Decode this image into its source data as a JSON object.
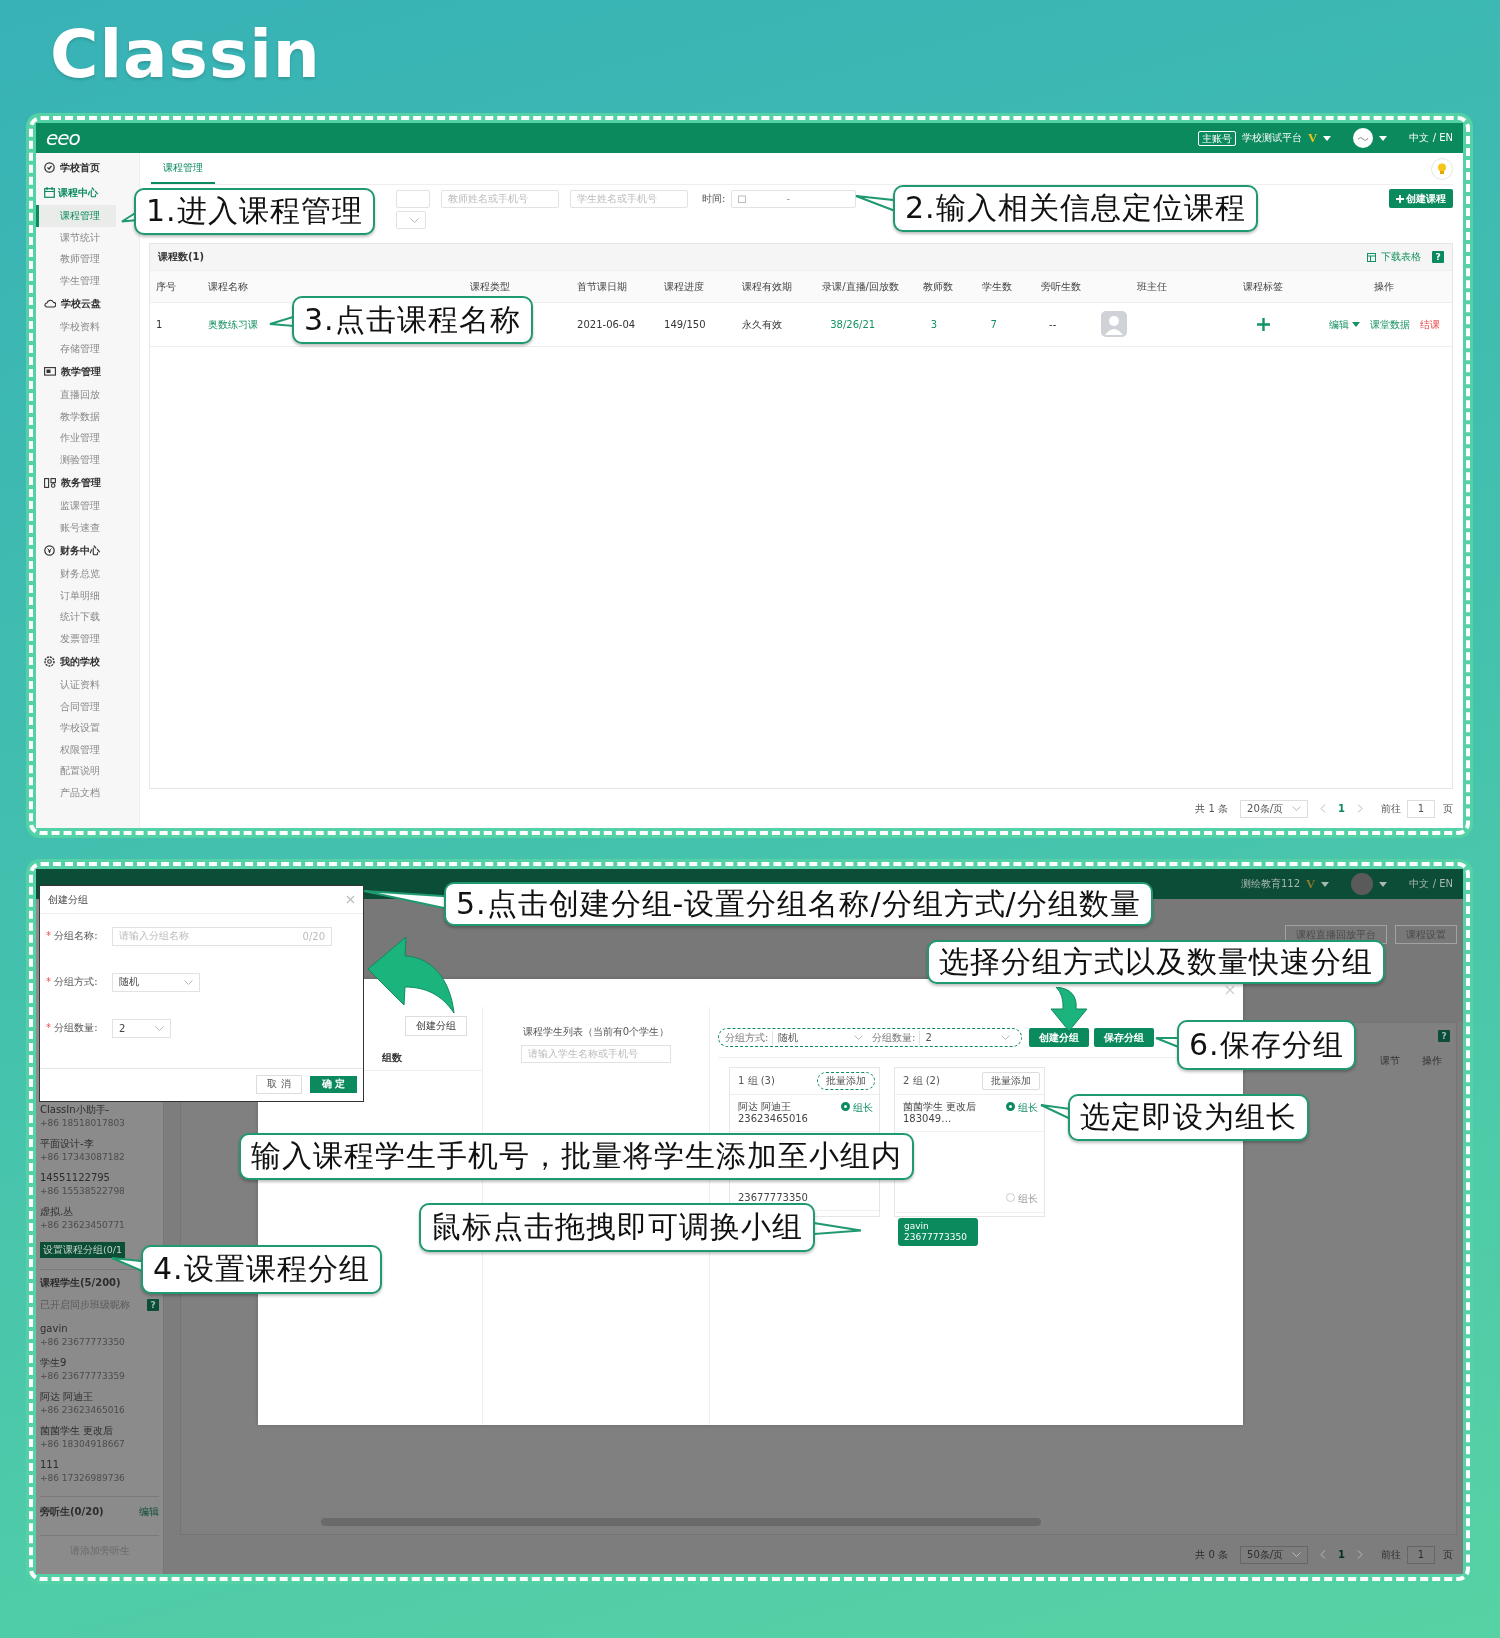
{
  "brand": {
    "logo": "Classin"
  },
  "course_management_screen": {
    "header": {
      "logo": "eeo",
      "account_badge": "主账号",
      "school": "学校测试平台",
      "vip_mark": "V",
      "language": "中文 / EN"
    },
    "sidebar": [
      {
        "label": "学校首页",
        "active": false
      },
      {
        "label": "课程中心",
        "active": true,
        "children": [
          {
            "label": "课程管理",
            "selected": true
          },
          {
            "label": "课节统计",
            "selected": false
          },
          {
            "label": "教师管理",
            "selected": false
          },
          {
            "label": "学生管理",
            "selected": false
          }
        ]
      },
      {
        "label": "学校云盘",
        "active": false,
        "children": [
          {
            "label": "学校资料",
            "selected": false
          },
          {
            "label": "存储管理",
            "selected": false
          }
        ]
      },
      {
        "label": "教学管理",
        "active": false,
        "children": [
          {
            "label": "直播回放",
            "selected": false
          },
          {
            "label": "教学数据",
            "selected": false
          },
          {
            "label": "作业管理",
            "selected": false
          },
          {
            "label": "测验管理",
            "selected": false
          }
        ]
      },
      {
        "label": "教务管理",
        "active": false,
        "children": [
          {
            "label": "监课管理",
            "selected": false
          },
          {
            "label": "账号速查",
            "selected": false
          }
        ]
      },
      {
        "label": "财务中心",
        "active": false,
        "children": [
          {
            "label": "财务总览",
            "selected": false
          },
          {
            "label": "订单明细",
            "selected": false
          },
          {
            "label": "统计下载",
            "selected": false
          },
          {
            "label": "发票管理",
            "selected": false
          }
        ]
      },
      {
        "label": "我的学校",
        "active": false,
        "children": [
          {
            "label": "认证资料",
            "selected": false
          },
          {
            "label": "合同管理",
            "selected": false
          },
          {
            "label": "学校设置",
            "selected": false
          },
          {
            "label": "权限管理",
            "selected": false
          },
          {
            "label": "配置说明",
            "selected": false
          },
          {
            "label": "产品文档",
            "selected": false
          }
        ]
      }
    ],
    "tabs": [
      {
        "label": "课程管理",
        "selected": true
      }
    ],
    "filters": {
      "teacher_placeholder": "教师姓名或手机号",
      "student_placeholder": "学生姓名或手机号",
      "time_label": "时间:",
      "date_separator": "-"
    },
    "create_button": "创建课程",
    "table": {
      "count_label": "课程数(1)",
      "download_label": "下载表格",
      "help": "?",
      "columns": [
        "序号",
        "课程名称",
        "课程类型",
        "首节课日期",
        "课程进度",
        "课程有效期",
        "录课/直播/回放数",
        "教师数",
        "学生数",
        "旁听生数",
        "班主任",
        "课程标签",
        "操作"
      ],
      "rows": [
        {
          "index": "1",
          "name": "奥数练习课",
          "first_date": "2021-06-04",
          "progress": "149/150",
          "validity": "永久有效",
          "recordings": "38/26/21",
          "teachers": "3",
          "students": "7",
          "auditors": "--",
          "actions": [
            "编辑",
            "课堂数据",
            "结课"
          ]
        }
      ]
    },
    "pagination": {
      "total": "共 1 条",
      "page_size": "20条/页",
      "current_page": "1",
      "goto_label": "前往",
      "goto_value": "1",
      "page_suffix": "页"
    },
    "annotations": [
      {
        "text": "1.进入课程管理"
      },
      {
        "text": "2.输入相关信息定位课程"
      },
      {
        "text": "3.点击课程名称"
      }
    ]
  },
  "grouping_screen": {
    "header": {
      "school": "测绘教育112",
      "vip_mark": "V",
      "language": "中文 / EN"
    },
    "top_buttons": [
      "课程直播回放平台",
      "课程设置"
    ],
    "sidebar": {
      "contacts": [
        {
          "name": "ClassIn小助手-",
          "phone": "+86 18518017803"
        },
        {
          "name": "平面设计-李",
          "phone": "+86 17343087182"
        },
        {
          "name": "14551122795",
          "phone": "+86 15538522798"
        },
        {
          "name": "虚拟.丛",
          "phone": "+86 23623450771"
        }
      ],
      "group_button": "设置课程分组(0/1",
      "students_header": "课程学生(5/200)",
      "sync_note": "已开启同步班级昵称",
      "help": "?",
      "students": [
        {
          "name": "gavin",
          "phone": "+86 23677773350"
        },
        {
          "name": "学生9",
          "phone": "+86 23677773359"
        },
        {
          "name": "阿达 阿迪王",
          "phone": "+86 23623465016"
        },
        {
          "name": "菌菌学生 更改后",
          "phone": "+86 18304918667"
        },
        {
          "name": "111",
          "phone": "+86 17326989736"
        }
      ],
      "auditors_header": "旁听生(0/20)",
      "auditors_edit": "编辑",
      "add_auditor": "请添加旁听生"
    },
    "table": {
      "help": "?",
      "columns": [
        "课节",
        "操作"
      ]
    },
    "pagination": {
      "total": "共 0 条",
      "page_size": "50条/页",
      "current_page": "1",
      "goto_label": "前往",
      "goto_value": "1",
      "page_suffix": "页"
    },
    "group_modal": {
      "create_button": "创建分组",
      "count_column": "组数",
      "student_list_title": "课程学生列表（当前有0个学生）",
      "student_search_placeholder": "请输入学生名称或手机号",
      "method_label": "分组方式:",
      "method_value": "随机",
      "count_label": "分组数量:",
      "count_value": "2",
      "create_groups_button": "创建分组",
      "save_groups_button": "保存分组",
      "groups": [
        {
          "title": "1 组 (3)",
          "batch_button": "批量添加",
          "highlighted": true,
          "members": [
            {
              "name": "阿达 阿迪王",
              "phone": "23623465016",
              "leader": true,
              "leader_label": "组长"
            },
            {
              "phone": "23677773350"
            }
          ]
        },
        {
          "title": "2 组 (2)",
          "batch_button": "批量添加",
          "highlighted": false,
          "members": [
            {
              "name": "菌菌学生 更改后",
              "phone": "183049…",
              "leader": true,
              "leader_label": "组长"
            },
            {
              "leader": false,
              "leader_label": "组长"
            }
          ]
        }
      ],
      "dragged_chip": {
        "name": "gavin",
        "phone": "23677773350"
      }
    },
    "create_dialog": {
      "title": "创建分组",
      "fields": [
        {
          "kind": "text",
          "required_mark": "*",
          "label": "分组名称:",
          "placeholder": "请输入分组名称",
          "counter": "0/20"
        },
        {
          "kind": "select",
          "required_mark": "*",
          "label": "分组方式:",
          "value": "随机"
        },
        {
          "kind": "select",
          "required_mark": "*",
          "label": "分组数量:",
          "value": "2"
        }
      ],
      "cancel": "取 消",
      "confirm": "确 定"
    },
    "annotations": [
      {
        "text": "5.点击创建分组-设置分组名称/分组方式/分组数量"
      },
      {
        "text": "选择分组方式以及数量快速分组"
      },
      {
        "text": "6.保存分组"
      },
      {
        "text": "选定即设为组长"
      },
      {
        "text": "输入课程学生手机号，批量将学生添加至小组内"
      },
      {
        "text": "鼠标点击拖拽即可调换小组"
      },
      {
        "text": "4.设置课程分组"
      }
    ]
  }
}
